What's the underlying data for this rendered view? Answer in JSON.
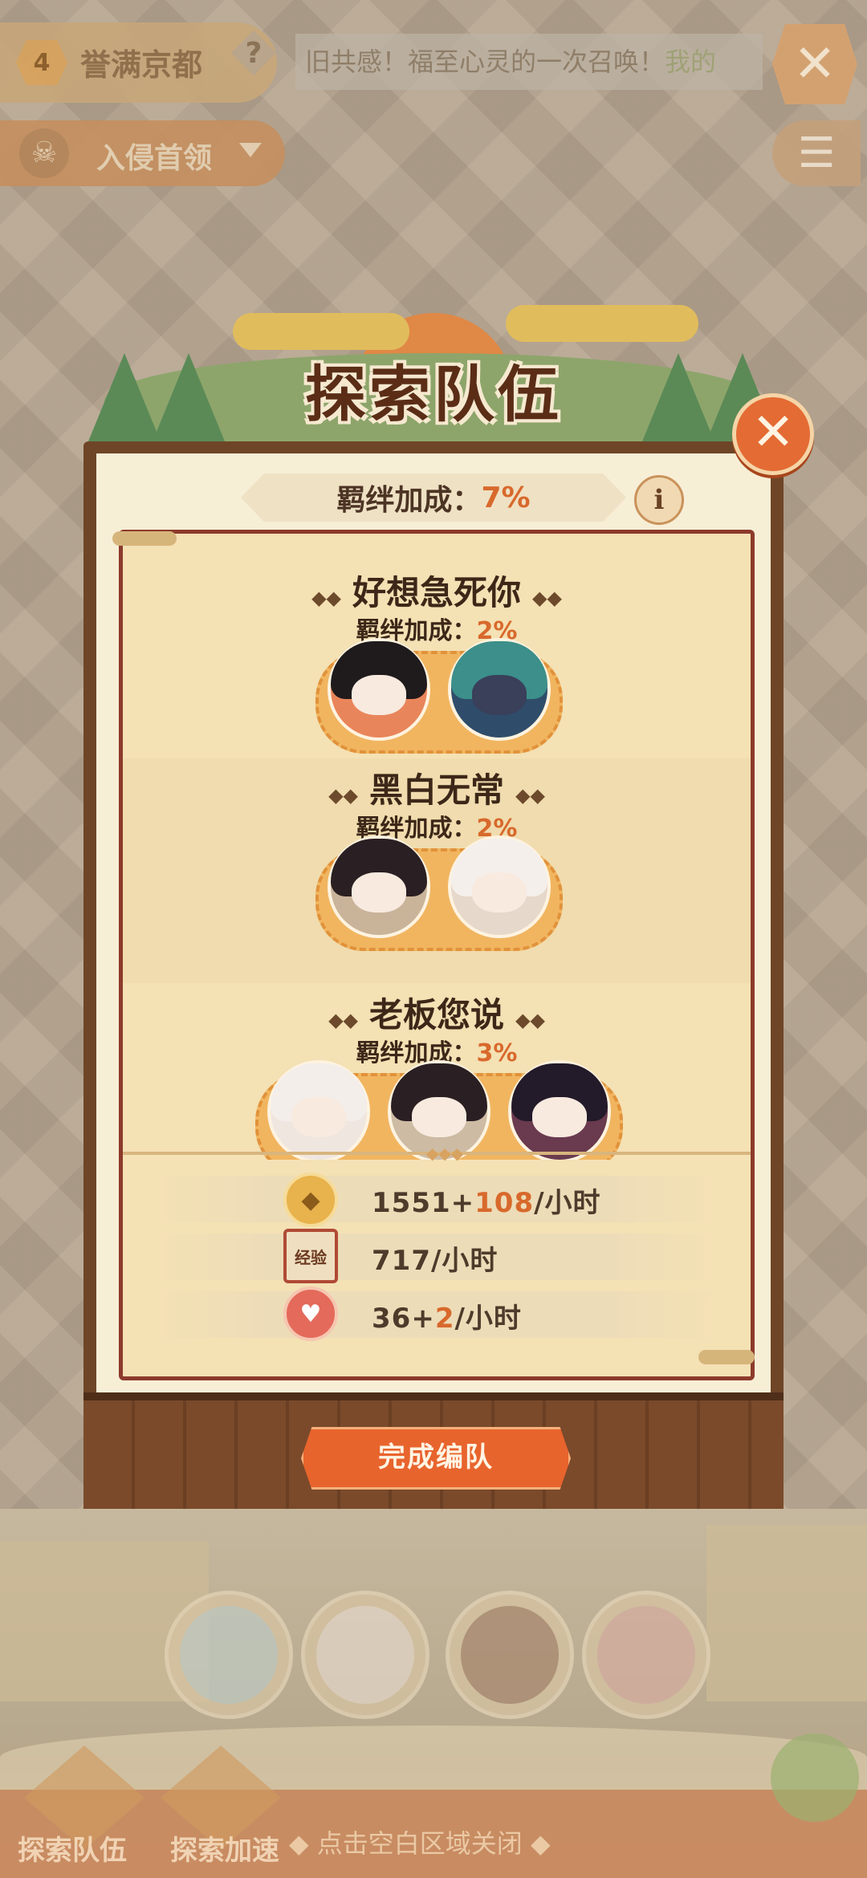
{
  "topbar": {
    "level": "4",
    "map_name": "誉满京都",
    "help": "?",
    "ticker_text": "旧共感！福至心灵的一次召唤！",
    "ticker_highlight": "我的",
    "close": "✕"
  },
  "invader": {
    "label": "入侵首领"
  },
  "modal": {
    "title": "探索队伍",
    "close": "✕",
    "bond_label": "羁绊加成：",
    "bond_value": "7%",
    "info": "i",
    "finish_button": "完成编队",
    "groups": [
      {
        "name": "好想急死你",
        "bond_label": "羁绊加成：",
        "bond_pct": "2%"
      },
      {
        "name": "黑白无常",
        "bond_label": "羁绊加成：",
        "bond_pct": "2%"
      },
      {
        "name": "老板您说",
        "bond_label": "羁绊加成：",
        "bond_pct": "3%"
      }
    ],
    "resources": [
      {
        "icon": "coin-icon",
        "base": "1551+",
        "bonus": "108",
        "unit": "/小时"
      },
      {
        "icon": "exp-scroll-icon",
        "base": "717",
        "bonus": "",
        "unit": "/小时",
        "icon_text": "经验"
      },
      {
        "icon": "meat-icon",
        "base": "36+",
        "bonus": "2",
        "unit": "/小时"
      }
    ]
  },
  "bottom": {
    "btn1": "探索队伍",
    "btn2": "探索加速",
    "hint": "◆ 点击空白区域关闭 ◆"
  },
  "colors": {
    "accent": "#d8692c",
    "frame": "#6f4527",
    "panel_border": "#8c3a2b"
  }
}
